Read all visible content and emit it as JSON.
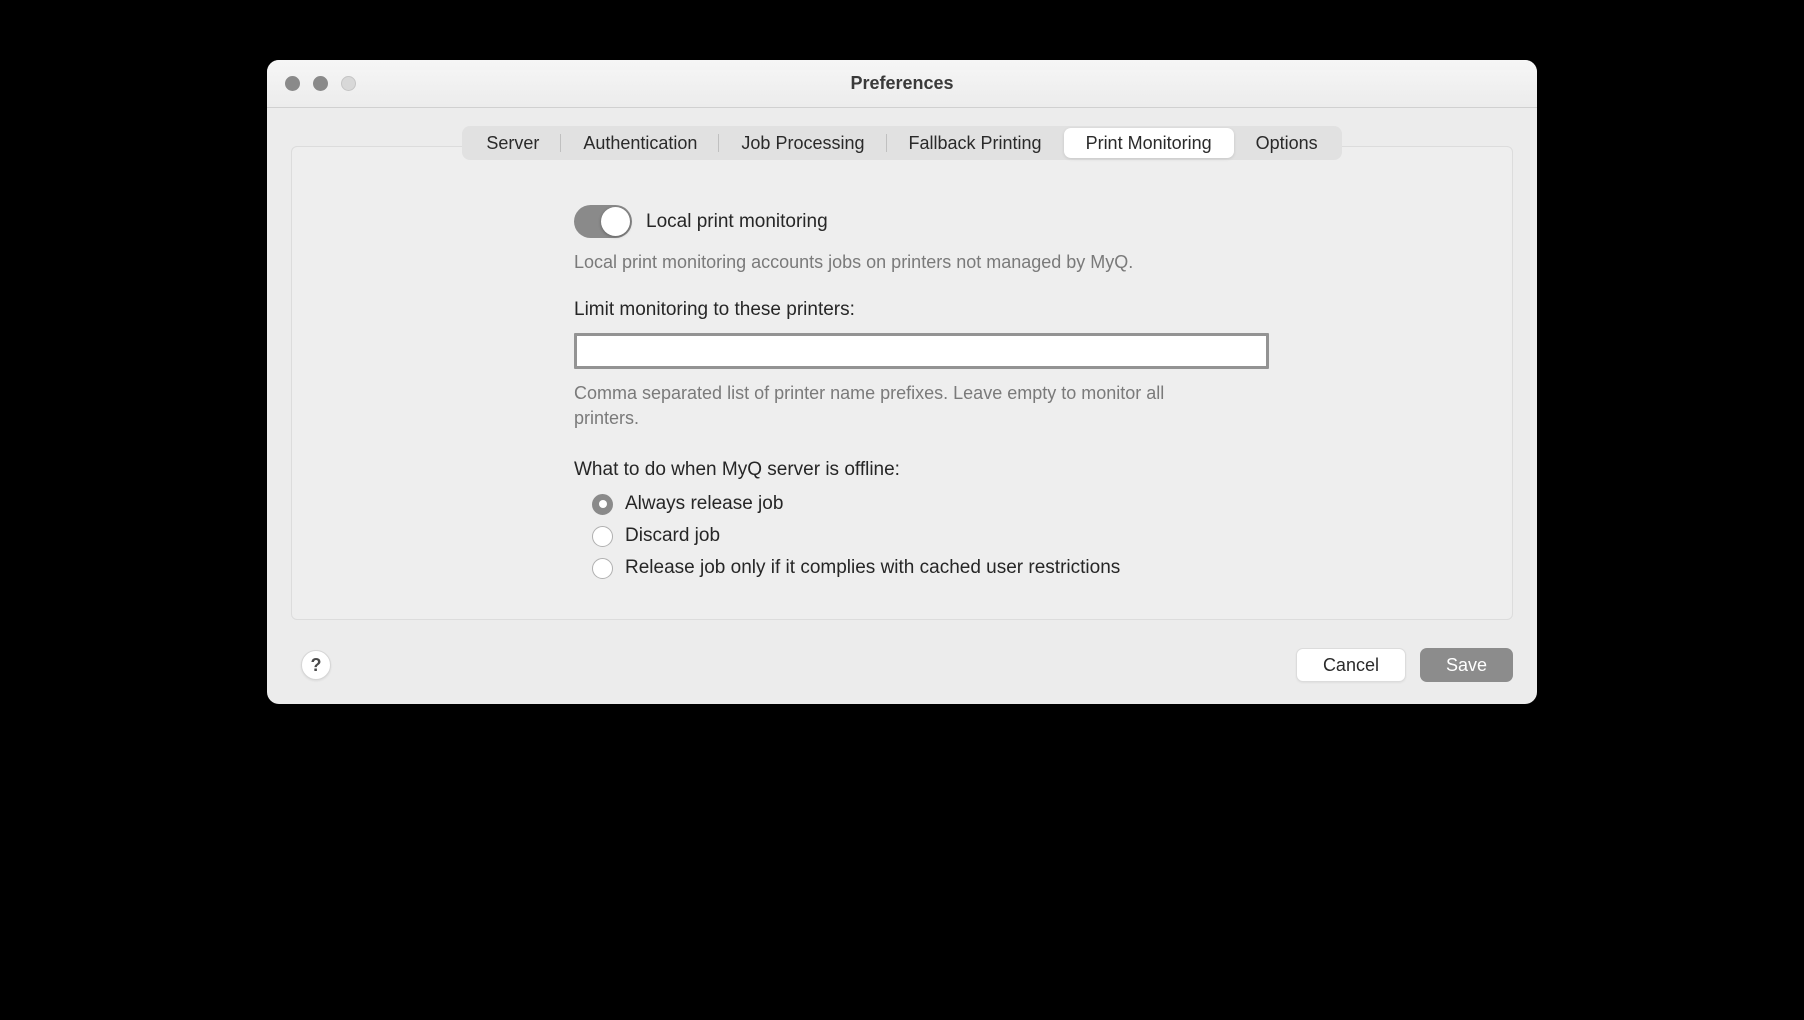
{
  "window": {
    "title": "Preferences"
  },
  "tabs": {
    "server": "Server",
    "authentication": "Authentication",
    "job_processing": "Job Processing",
    "fallback_printing": "Fallback Printing",
    "print_monitoring": "Print Monitoring",
    "options": "Options",
    "active": "print_monitoring"
  },
  "monitoring": {
    "toggle_label": "Local print monitoring",
    "toggle_on": true,
    "description": "Local print monitoring accounts jobs on printers not managed by MyQ.",
    "limit_label": "Limit monitoring to these printers:",
    "limit_value": "",
    "limit_hint": "Comma separated list of printer name prefixes. Leave empty to monitor all printers.",
    "offline_label": "What to do when MyQ server is offline:",
    "offline_options": {
      "always": "Always release job",
      "discard": "Discard job",
      "cached": "Release job only if it complies with cached user restrictions"
    },
    "offline_selected": "always"
  },
  "footer": {
    "help": "?",
    "cancel": "Cancel",
    "save": "Save"
  }
}
